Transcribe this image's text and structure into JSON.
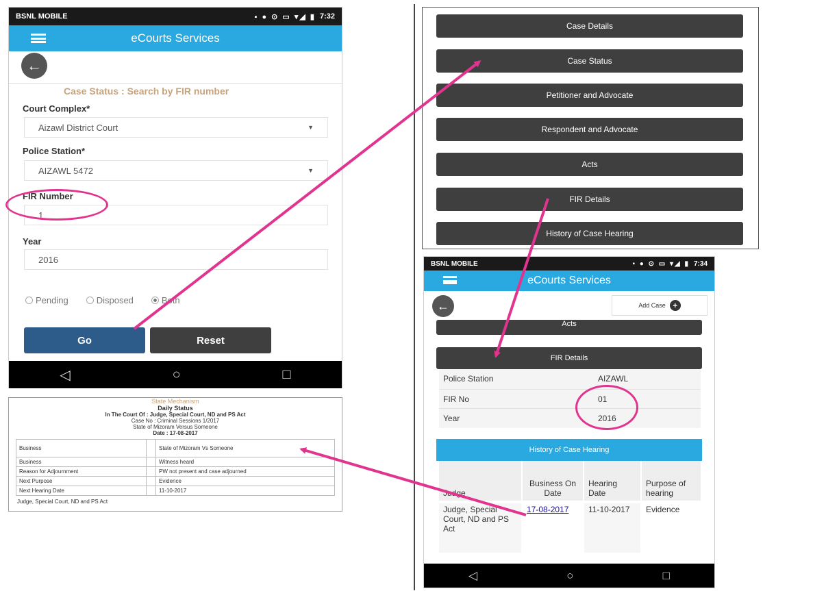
{
  "colors": {
    "accent": "#29a9df",
    "arrow": "#e0348f",
    "button": "#3f3f3f",
    "go": "#2e5c8a"
  },
  "left_phone": {
    "status": {
      "carrier": "BSNL MOBILE",
      "time": "7:32"
    },
    "app_title": "eCourts Services",
    "form_title": "Case Status : Search by FIR number",
    "court_complex_label": "Court Complex*",
    "court_complex_value": "Aizawl District Court",
    "police_station_label": "Police Station*",
    "police_station_value": "AIZAWL 5472",
    "fir_label": "FIR Number",
    "fir_value": "1",
    "year_label": "Year",
    "year_value": "2016",
    "radios": [
      "Pending",
      "Disposed",
      "Both"
    ],
    "go_label": "Go",
    "reset_label": "Reset"
  },
  "right_top": {
    "buttons": [
      "Case Details",
      "Case Status",
      "Petitioner and Advocate",
      "Respondent and Advocate",
      "Acts",
      "FIR Details",
      "History of Case Hearing"
    ]
  },
  "right_phone": {
    "status": {
      "carrier": "BSNL MOBILE",
      "time": "7:34"
    },
    "app_title": "eCourts Services",
    "add_case": "Add Case",
    "acts_label": "Acts",
    "fir_details_label": "FIR Details",
    "fir_rows": [
      {
        "label": "Police Station",
        "value": "AIZAWL"
      },
      {
        "label": "FIR No",
        "value": "01"
      },
      {
        "label": "Year",
        "value": "2016"
      }
    ],
    "history_header": "History of Case Hearing",
    "history_columns": [
      "Judge",
      "Business On Date",
      "Hearing Date",
      "Purpose of hearing"
    ],
    "history_row": {
      "judge": "Judge, Special Court, ND and PS Act",
      "business_date": "17-08-2017",
      "hearing_date": "11-10-2017",
      "purpose": "Evidence"
    }
  },
  "business_doc": {
    "court": "State Mechanism",
    "heading": "Daily Status",
    "line1": "In The Court Of : Judge, Special Court, ND and PS Act",
    "line2": "Case No : Criminal Sessions 1/2017",
    "line3": "State of Mizoram Versus Someone",
    "line4": "Date : 17-08-2017",
    "rows": [
      {
        "label": "Business",
        "value": "State of Mizoram Vs Someone"
      },
      {
        "label": "Business",
        "value": "Witness heard"
      },
      {
        "label": "Reason for Adjournment",
        "value": "PW not present and case adjourned"
      },
      {
        "label": "Next Purpose",
        "value": "Evidence"
      },
      {
        "label": "Next Hearing Date",
        "value": "11-10-2017"
      }
    ],
    "footer": "Judge, Special Court, ND and PS Act"
  }
}
